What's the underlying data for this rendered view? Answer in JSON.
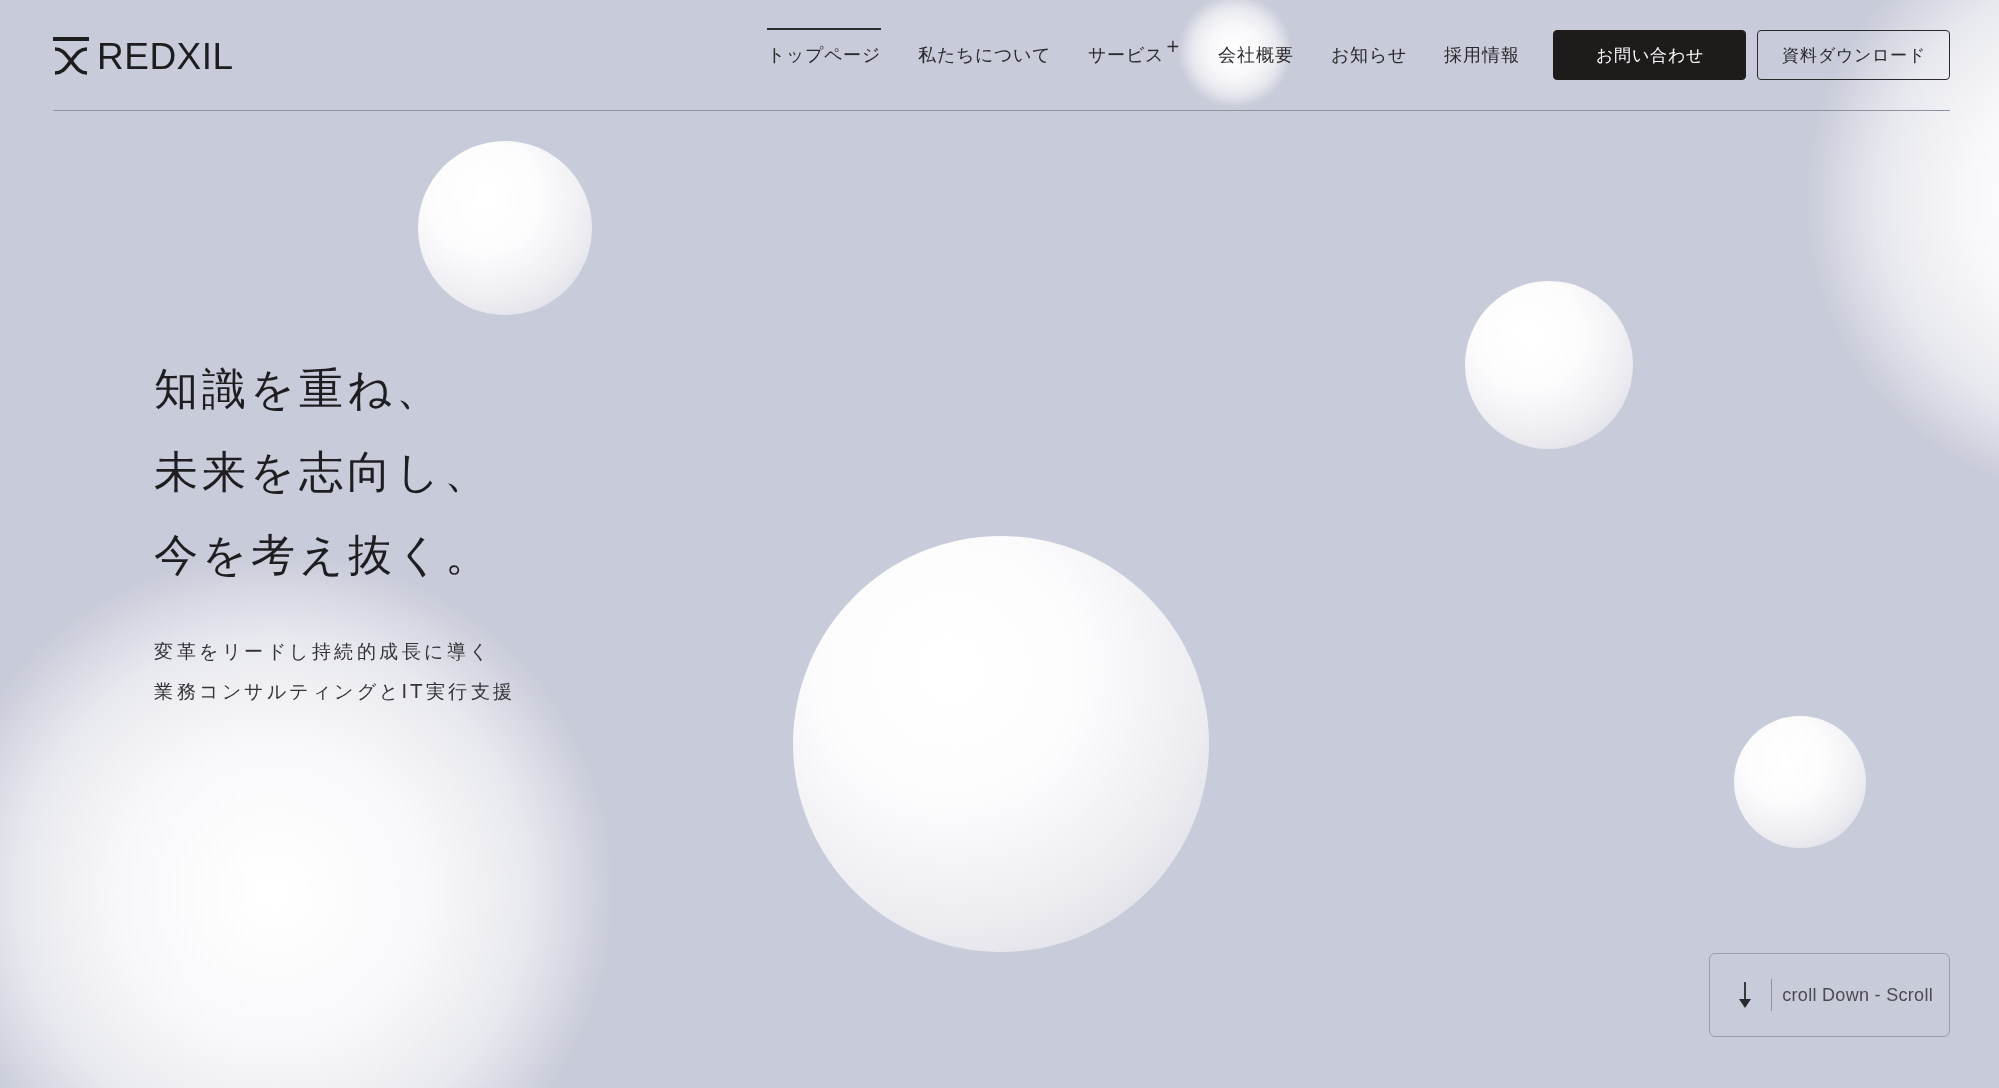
{
  "header": {
    "logo": {
      "text": "REDXIL"
    },
    "nav": [
      {
        "label": "トップページ",
        "selected": true
      },
      {
        "label": "私たちについて",
        "selected": false
      },
      {
        "label": "サービス",
        "suffix": "+",
        "selected": false
      },
      {
        "label": "会社概要",
        "selected": false
      },
      {
        "label": "お知らせ",
        "selected": false
      },
      {
        "label": "採用情報",
        "selected": false
      }
    ],
    "buttons": [
      {
        "label": "お問い合わせ",
        "kind": "primary"
      },
      {
        "label": "資料ダウンロード",
        "kind": "outline"
      }
    ]
  },
  "hero": {
    "headline": [
      "知識を重ね、",
      "未来を志向し、",
      "今を考え抜く。"
    ],
    "subtitle": [
      "変革をリードし持続的成長に導く",
      "業務コンサルティングとIT実行支援"
    ]
  },
  "scroll_button": {
    "text": "croll Down - Scroll"
  }
}
